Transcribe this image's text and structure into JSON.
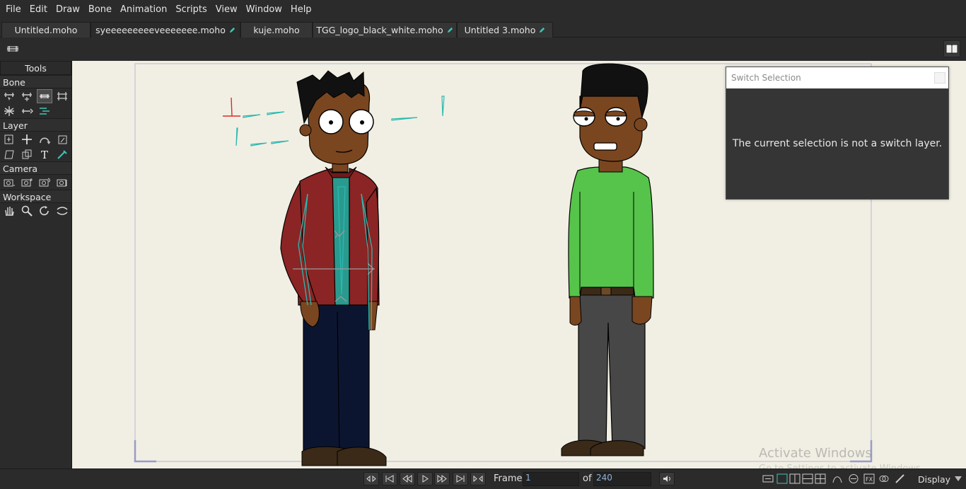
{
  "menu": [
    "File",
    "Edit",
    "Draw",
    "Bone",
    "Animation",
    "Scripts",
    "View",
    "Window",
    "Help"
  ],
  "tabs": [
    {
      "label": "Untitled.moho",
      "modified": false,
      "active": false
    },
    {
      "label": "syeeeeeeeeeveeeeeee.moho",
      "modified": true,
      "active": true
    },
    {
      "label": "kuje.moho",
      "modified": false,
      "active": false
    },
    {
      "label": "TGG_logo_black_white.moho",
      "modified": true,
      "active": false
    },
    {
      "label": "Untitled 3.moho",
      "modified": true,
      "active": false
    }
  ],
  "tools_panel": {
    "title": "Tools",
    "sections": {
      "bone": "Bone",
      "layer": "Layer",
      "camera": "Camera",
      "workspace": "Workspace"
    }
  },
  "switch_panel": {
    "title": "Switch Selection",
    "message": "The current selection is not a switch layer."
  },
  "playback": {
    "frame_label": "Frame",
    "frame_value": "1",
    "of_label": "of",
    "total_frames": "240"
  },
  "display_label": "Display",
  "watermark": {
    "title": "Activate Windows",
    "subtitle": "Go to Settings to activate Windows."
  },
  "colors": {
    "canvas_bg": "#f1efe3",
    "bone_color": "#2bb8b0",
    "skin": "#7a4620",
    "shirt_green": "#56c44a",
    "jacket_red": "#8b2424"
  }
}
